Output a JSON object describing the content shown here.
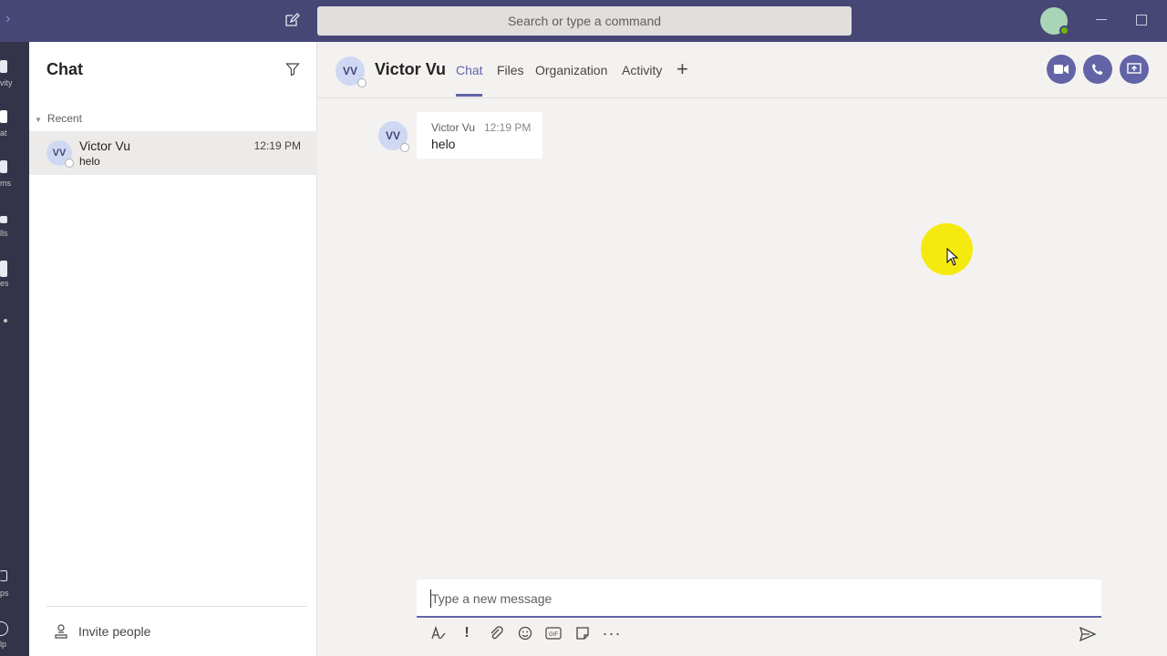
{
  "topbar": {
    "search_placeholder": "Search or type a command"
  },
  "rail": {
    "items": [
      {
        "label": "vity",
        "icon": "bell-icon"
      },
      {
        "label": "at",
        "icon": "chat-icon"
      },
      {
        "label": "ms",
        "icon": "teams-icon"
      },
      {
        "label": "lls",
        "icon": "phone-icon"
      },
      {
        "label": "es",
        "icon": "files-icon"
      }
    ],
    "bottom": [
      {
        "label": "ps",
        "icon": "apps-icon"
      },
      {
        "label": "lp",
        "icon": "help-icon"
      }
    ]
  },
  "list": {
    "title": "Chat",
    "section": "Recent",
    "items": [
      {
        "initials": "VV",
        "name": "Victor Vu",
        "preview": "helo",
        "time": "12:19 PM"
      }
    ],
    "invite": "Invite people"
  },
  "header": {
    "initials": "VV",
    "name": "Victor Vu",
    "tabs": [
      "Chat",
      "Files",
      "Organization",
      "Activity"
    ],
    "active_tab": "Chat",
    "accent": "#6264a7"
  },
  "messages": [
    {
      "initials": "VV",
      "author": "Victor Vu",
      "time": "12:19 PM",
      "text": "helo"
    }
  ],
  "compose": {
    "placeholder": "Type a new message"
  },
  "colors": {
    "topbar": "#464775",
    "rail": "#33344a",
    "highlight": "#f5ea10"
  }
}
